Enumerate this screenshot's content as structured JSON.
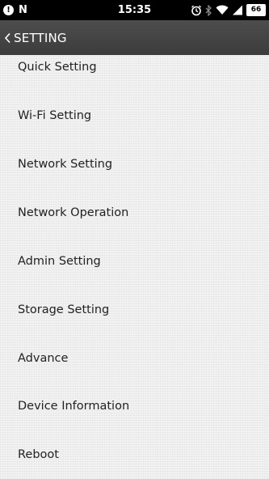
{
  "status_bar": {
    "time": "15:35",
    "battery": "66",
    "left_icons": [
      "alert-icon",
      "n-icon"
    ],
    "right_icons": [
      "alarm-icon",
      "bluetooth-icon",
      "wifi-icon",
      "signal-icon",
      "battery-icon"
    ]
  },
  "app_bar": {
    "title": "SETTING",
    "back_icon": "chevron-left-icon",
    "background": "#444444"
  },
  "menu": {
    "items": [
      {
        "label": "Quick Setting"
      },
      {
        "label": "Wi-Fi Setting"
      },
      {
        "label": "Network Setting"
      },
      {
        "label": "Network Operation"
      },
      {
        "label": "Admin Setting"
      },
      {
        "label": "Storage Setting"
      },
      {
        "label": "Advance"
      },
      {
        "label": "Device Information"
      },
      {
        "label": "Reboot"
      }
    ]
  }
}
